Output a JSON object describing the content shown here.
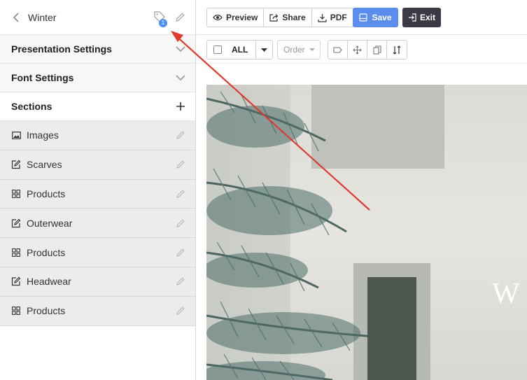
{
  "sidebar": {
    "title": "Winter",
    "tag_badge": "1",
    "sections": [
      {
        "label": "Presentation Settings",
        "action_icon": "chevron-down-icon"
      },
      {
        "label": "Font Settings",
        "action_icon": "chevron-down-icon"
      },
      {
        "label": "Sections",
        "action_icon": "plus-icon"
      }
    ],
    "items": [
      {
        "label": "Images",
        "icon": "image-icon"
      },
      {
        "label": "Scarves",
        "icon": "edit-box-icon"
      },
      {
        "label": "Products",
        "icon": "grid-icon"
      },
      {
        "label": "Outerwear",
        "icon": "edit-box-icon"
      },
      {
        "label": "Products",
        "icon": "grid-icon"
      },
      {
        "label": "Headwear",
        "icon": "edit-box-icon"
      },
      {
        "label": "Products",
        "icon": "grid-icon"
      }
    ]
  },
  "toolbar": {
    "preview_label": "Preview",
    "share_label": "Share",
    "pdf_label": "PDF",
    "save_label": "Save",
    "exit_label": "Exit"
  },
  "toolbar2": {
    "all_label": "ALL",
    "order_placeholder": "Order"
  },
  "preview": {
    "overlay_text": "W"
  },
  "colors": {
    "save_bg": "#5b8def",
    "exit_bg": "#3b3b45",
    "badge_bg": "#4f8ef7",
    "arrow": "#e03a2f"
  }
}
